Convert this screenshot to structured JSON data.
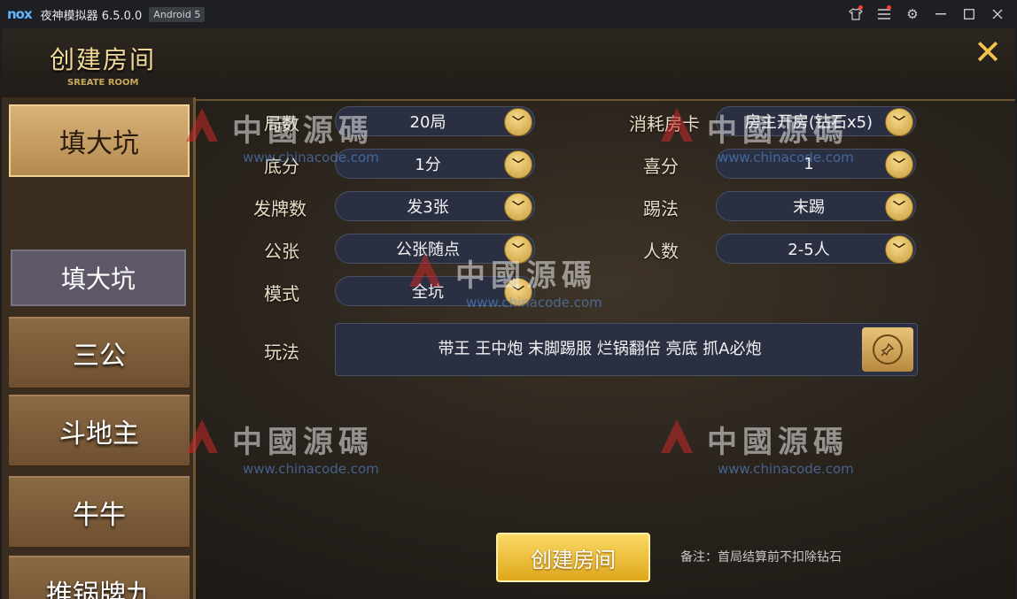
{
  "emulator": {
    "logo": "nox",
    "title": "夜神模拟器 6.5.0.0",
    "android_badge": "Android 5",
    "icons": [
      "shirt-icon",
      "menu-icon",
      "gear-icon",
      "minimize-icon",
      "maximize-icon",
      "close-icon"
    ]
  },
  "header": {
    "title": "创建房间",
    "subtitle": "SREATE ROOM",
    "close_icon": "close-x-icon"
  },
  "side_menu": {
    "items": [
      {
        "label": "填大坑",
        "active": true
      },
      {
        "label": "三公",
        "active": false
      },
      {
        "label": "斗地主",
        "active": false
      },
      {
        "label": "牛牛",
        "active": false
      },
      {
        "label": "推锅牌九",
        "active": false
      }
    ],
    "sub_tab": "填大坑"
  },
  "options": {
    "rounds": {
      "label": "局数",
      "value": "20局"
    },
    "base_score": {
      "label": "底分",
      "value": "1分"
    },
    "deal_count": {
      "label": "发牌数",
      "value": "发3张"
    },
    "public_cards": {
      "label": "公张",
      "value": "公张随点"
    },
    "mode": {
      "label": "模式",
      "value": "全坑"
    },
    "room_card": {
      "label": "消耗房卡",
      "value": "房主开房(钻石x5)"
    },
    "bonus_score": {
      "label": "喜分",
      "value": "1"
    },
    "kick_rule": {
      "label": "踢法",
      "value": "末踢"
    },
    "players": {
      "label": "人数",
      "value": "2-5人"
    },
    "rules": {
      "label": "玩法",
      "value": "带王 王中炮 末脚踢服 烂锅翻倍 亮底 抓A必炮"
    }
  },
  "actions": {
    "create_label": "创建房间",
    "note": "备注：首局结算前不扣除钻石"
  },
  "watermark": {
    "text": "中國源碼",
    "url": "www.chinacode.com"
  },
  "colors": {
    "accent_gold": "#f2c44b",
    "select_bg": "#2a3042",
    "active_tab": "#d8b27a"
  }
}
